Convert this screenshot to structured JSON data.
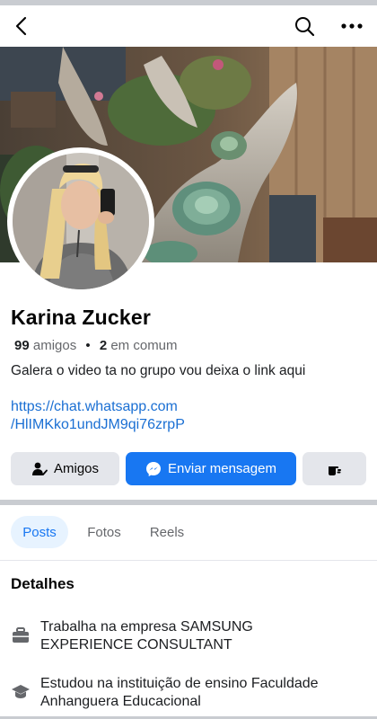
{
  "topbar": {
    "back_icon": "back-arrow-icon",
    "search_icon": "search-icon",
    "more_icon": "more-horizontal-icon"
  },
  "profile": {
    "name": "Karina Zucker",
    "friends_count": "99",
    "friends_label": "amigos",
    "mutual_count": "2",
    "mutual_label": "em comum",
    "bio": "Galera o video ta no grupo vou deixa o link aqui",
    "link_line1": "https://chat.whatsapp.com",
    "link_line2": "/HlIMKko1undJM9qi76zrpP"
  },
  "actions": {
    "friends_label": "Amigos",
    "message_label": "Enviar mensagem",
    "more_icon": "hand-wave-icon"
  },
  "tabs": [
    {
      "label": "Posts",
      "active": true
    },
    {
      "label": "Fotos",
      "active": false
    },
    {
      "label": "Reels",
      "active": false
    }
  ],
  "details": {
    "title": "Detalhes",
    "work_line1": "Trabalha na empresa SAMSUNG",
    "work_line2": "EXPERIENCE CONSULTANT",
    "edu_line1": "Estudou na instituição de ensino Faculdade",
    "edu_line2": "Anhanguera Educacional"
  },
  "colors": {
    "accent": "#1877f2",
    "link": "#1a6fd3",
    "button_gray": "#e4e6eb",
    "secondary_text": "#65676b"
  }
}
